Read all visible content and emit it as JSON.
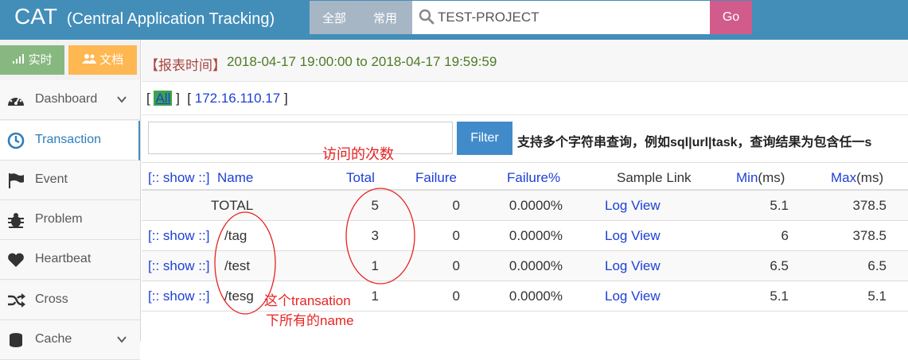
{
  "header": {
    "brand": "CAT",
    "subtitle": "(Central Application Tracking)",
    "tabs": [
      "全部",
      "常用"
    ],
    "search_value": "TEST-PROJECT",
    "go_label": "Go"
  },
  "sidebar": {
    "realtime_label": "实时",
    "docs_label": "文档",
    "items": [
      {
        "label": "Dashboard",
        "icon": "dashboard-icon",
        "expandable": true
      },
      {
        "label": "Transaction",
        "icon": "clock-icon",
        "active": true
      },
      {
        "label": "Event",
        "icon": "flag-icon"
      },
      {
        "label": "Problem",
        "icon": "bug-icon"
      },
      {
        "label": "Heartbeat",
        "icon": "heart-icon"
      },
      {
        "label": "Cross",
        "icon": "random-icon"
      },
      {
        "label": "Cache",
        "icon": "database-icon",
        "expandable": true
      }
    ]
  },
  "report": {
    "label": "【报表时间】",
    "range": "2018-04-17 19:00:00 to 2018-04-17 19:59:59"
  },
  "ips": {
    "all": "All",
    "ip": "172.16.110.17",
    "bracket_open": "[",
    "bracket_close": "]"
  },
  "filter": {
    "value": "",
    "button": "Filter",
    "hint": "支持多个字符串查询，例如sql|url|task，查询结果为包含任一s"
  },
  "table": {
    "headers": {
      "show": "[:: show ::]",
      "name": "Name",
      "total": "Total",
      "failure": "Failure",
      "failure_pct": "Failure%",
      "sample": "Sample Link",
      "min": "Min",
      "min_unit": "(ms)",
      "max": "Max",
      "max_unit": "(ms)"
    },
    "rows": [
      {
        "show": "",
        "name": "TOTAL",
        "total": "5",
        "failure": "0",
        "failure_pct": "0.0000%",
        "sample": "Log View",
        "min": "5.1",
        "max": "378.5"
      },
      {
        "show": "[:: show ::]",
        "name": "/tag",
        "total": "3",
        "failure": "0",
        "failure_pct": "0.0000%",
        "sample": "Log View",
        "min": "6",
        "max": "378.5"
      },
      {
        "show": "[:: show ::]",
        "name": "/test",
        "total": "1",
        "failure": "0",
        "failure_pct": "0.0000%",
        "sample": "Log View",
        "min": "6.5",
        "max": "6.5"
      },
      {
        "show": "[:: show ::]",
        "name": "/tesg",
        "total": "1",
        "failure": "0",
        "failure_pct": "0.0000%",
        "sample": "Log View",
        "min": "5.1",
        "max": "5.1"
      }
    ]
  },
  "annotations": {
    "visits": "访问的次数",
    "names_line1": "这个transation",
    "names_line2": "下所有的name",
    "color": "#e82323"
  },
  "colors": {
    "topbar": "#438eb9",
    "go": "#d15b8b",
    "realtime": "#87b87f",
    "docs": "#ffb752",
    "filter": "#428bca",
    "link": "#1d3fd6"
  }
}
